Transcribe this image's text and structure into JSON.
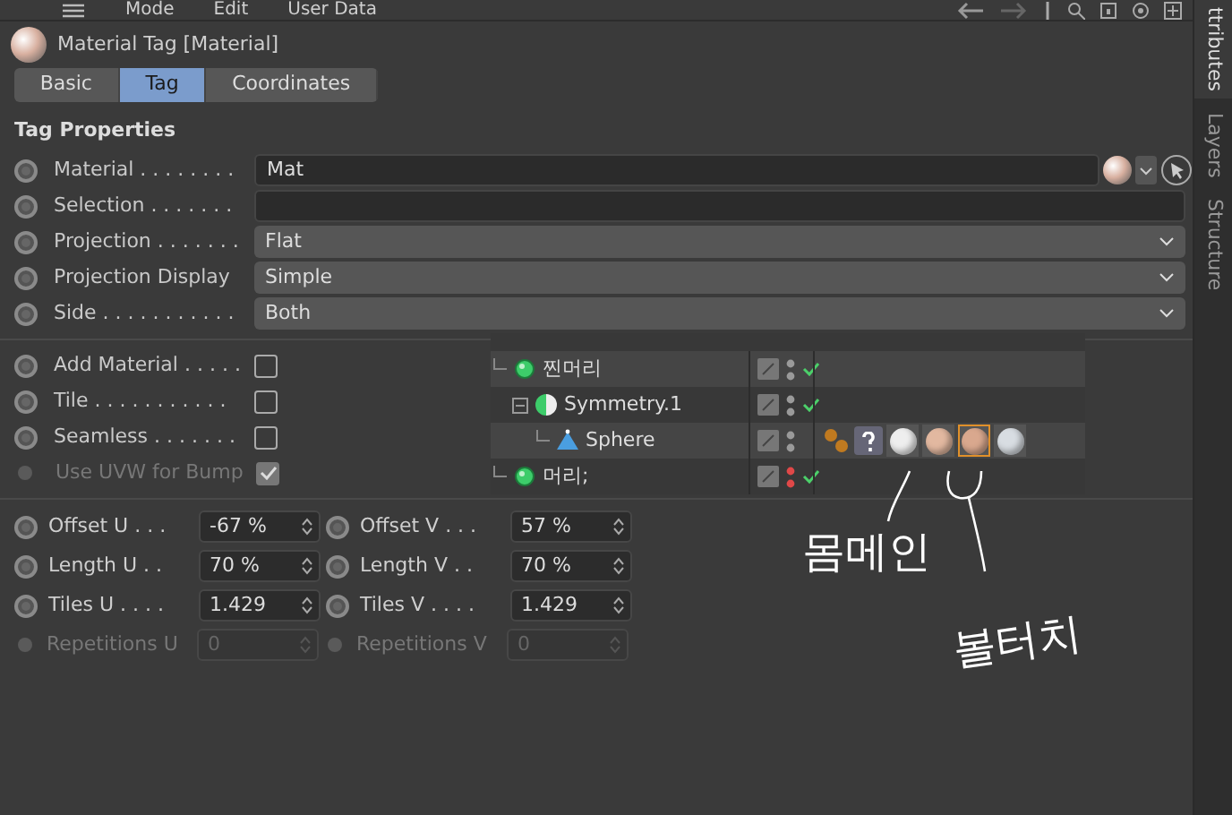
{
  "menu": [
    "Mode",
    "Edit",
    "User Data"
  ],
  "header": {
    "title": "Material Tag [Material]"
  },
  "tabs": [
    {
      "label": "Basic",
      "selected": false
    },
    {
      "label": "Tag",
      "selected": true
    },
    {
      "label": "Coordinates",
      "selected": false
    }
  ],
  "side_tabs": [
    {
      "label": "ttributes",
      "selected": true
    },
    {
      "label": "Layers",
      "selected": false
    },
    {
      "label": "Structure",
      "selected": false
    }
  ],
  "section_title": "Tag Properties",
  "properties": [
    {
      "kind": "link",
      "label": "Material . . . . . . . .",
      "value": "Mat"
    },
    {
      "kind": "text",
      "label": "Selection . . . . . . ."
    },
    {
      "kind": "dropdown",
      "label": "Projection . . . . . . .",
      "value": "Flat"
    },
    {
      "kind": "dropdown",
      "label": "Projection Display",
      "value": "Simple"
    },
    {
      "kind": "dropdown",
      "label": "Side . . . . . . . . . . .",
      "value": "Both"
    }
  ],
  "options": [
    {
      "label": "Add Material . . . . .",
      "checked": false,
      "disabled": false
    },
    {
      "label": "Tile . . . . . . . . . . .",
      "checked": false,
      "disabled": false
    },
    {
      "label": "Seamless . . . . . . .",
      "checked": false,
      "disabled": false
    },
    {
      "label": "Use UVW for Bump",
      "checked": true,
      "disabled": true
    }
  ],
  "coordinates": [
    {
      "label": "Offset U . . .",
      "value": "-67 %",
      "disabled": false
    },
    {
      "label": "Offset V . . .",
      "value": "57 %",
      "disabled": false
    },
    {
      "label": "Length U . .",
      "value": "70 %",
      "disabled": false
    },
    {
      "label": "Length V . .",
      "value": "70 %",
      "disabled": false
    },
    {
      "label": "Tiles U . . . .",
      "value": "1.429",
      "disabled": false
    },
    {
      "label": "Tiles V . . . .",
      "value": "1.429",
      "disabled": false
    },
    {
      "label": "Repetitions U",
      "value": "0",
      "disabled": true
    },
    {
      "label": "Repetitions V",
      "value": "0",
      "disabled": true
    }
  ],
  "object_tree": [
    {
      "name": "찐머리",
      "kind": "null",
      "selected": true,
      "color": "#9a9a9a",
      "enabled": true,
      "children": [
        {
          "name": "Symmetry.1",
          "kind": "symmetry",
          "selected": false,
          "color": "#9a9a9a",
          "enabled": true,
          "expanded": true,
          "children": [
            {
              "name": "Sphere",
              "kind": "polygon",
              "selected": true,
              "color": "#9a9a9a",
              "enabled": false,
              "tags": [
                {
                  "kind": "texture"
                },
                {
                  "kind": "unknown"
                },
                {
                  "kind": "material",
                  "color": "#eeeeee",
                  "selected": false
                },
                {
                  "kind": "material",
                  "color": "#e2b8a0",
                  "selected": false
                },
                {
                  "kind": "material",
                  "color": "#d9a88e",
                  "selected": true
                },
                {
                  "kind": "material",
                  "color": "#d8dde2",
                  "selected": false
                }
              ]
            }
          ]
        }
      ]
    },
    {
      "name": "머리;",
      "kind": "null",
      "selected": false,
      "color": "#e04848",
      "enabled": true
    }
  ],
  "annotations": [
    "몸메인",
    "볼터치"
  ]
}
